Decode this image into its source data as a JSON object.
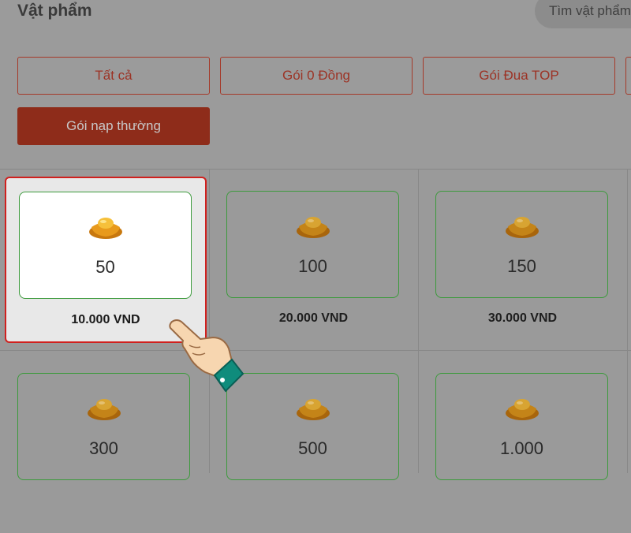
{
  "header": {
    "title": "Vật phẩm",
    "search_placeholder": "Tìm vật phẩm"
  },
  "filters": [
    {
      "label": "Tất cả",
      "active": false
    },
    {
      "label": "Gói 0 Đồng",
      "active": false
    },
    {
      "label": "Gói Đua TOP",
      "active": false
    },
    {
      "label": "Gói nạp thường",
      "active": true
    }
  ],
  "items": [
    {
      "amount": "50",
      "price": "10.000 VND",
      "selected": true
    },
    {
      "amount": "100",
      "price": "20.000 VND",
      "selected": false
    },
    {
      "amount": "150",
      "price": "30.000 VND",
      "selected": false
    },
    {
      "amount": "300",
      "price": "",
      "selected": false
    },
    {
      "amount": "500",
      "price": "",
      "selected": false
    },
    {
      "amount": "1.000",
      "price": "",
      "selected": false
    }
  ],
  "icons": {
    "item": "gold-ingot-icon",
    "pointer": "pointing-hand-icon"
  },
  "colors": {
    "accent": "#8e2c1a",
    "border_red": "#a53a2a",
    "selected_border": "#d0201e",
    "item_border": "#3c9a3c"
  }
}
